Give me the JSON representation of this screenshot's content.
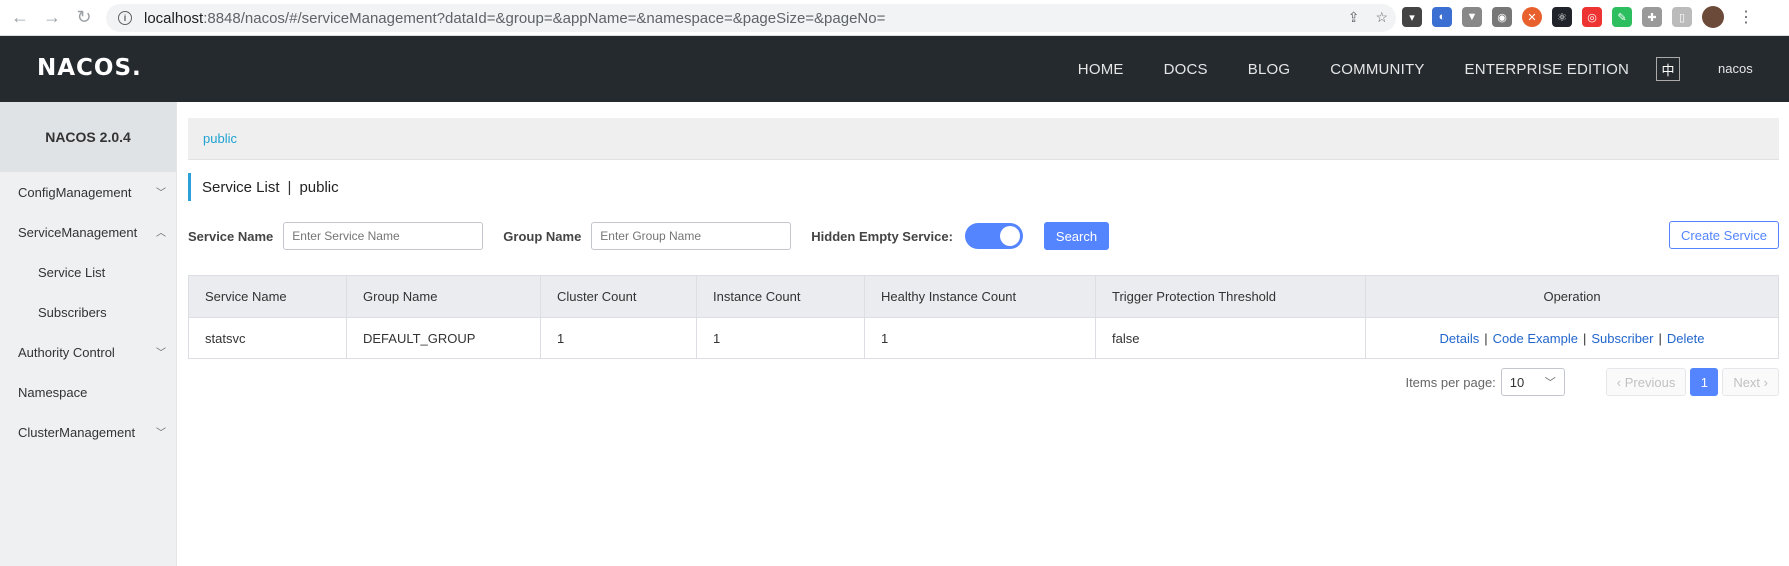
{
  "browser": {
    "url_host": "localhost",
    "url_rest": ":8848/nacos/#/serviceManagement?dataId=&group=&appName=&namespace=&pageSize=&pageNo="
  },
  "header": {
    "logo": "NACOS.",
    "nav": [
      "HOME",
      "DOCS",
      "BLOG",
      "COMMUNITY",
      "ENTERPRISE EDITION"
    ],
    "lang": "中",
    "user": "nacos"
  },
  "sidebar": {
    "title": "NACOS 2.0.4",
    "items": [
      {
        "label": "ConfigManagement",
        "chevron": "v"
      },
      {
        "label": "ServiceManagement",
        "chevron": "^"
      },
      {
        "label": "Service List",
        "chevron": ""
      },
      {
        "label": "Subscribers",
        "chevron": ""
      },
      {
        "label": "Authority Control",
        "chevron": "v"
      },
      {
        "label": "Namespace",
        "chevron": ""
      },
      {
        "label": "ClusterManagement",
        "chevron": "v"
      }
    ]
  },
  "namespace": {
    "current": "public"
  },
  "page": {
    "title": "Service List",
    "namespace": "public"
  },
  "search": {
    "service_label": "Service Name",
    "service_placeholder": "Enter Service Name",
    "group_label": "Group Name",
    "group_placeholder": "Enter Group Name",
    "hidden_label": "Hidden Empty Service:",
    "hidden_on": true,
    "search_button": "Search",
    "create_button": "Create Service"
  },
  "table": {
    "columns": [
      "Service Name",
      "Group Name",
      "Cluster Count",
      "Instance Count",
      "Healthy Instance Count",
      "Trigger Protection Threshold",
      "Operation"
    ],
    "rows": [
      {
        "service": "statsvc",
        "group": "DEFAULT_GROUP",
        "clusters": "1",
        "instances": "1",
        "healthy": "1",
        "threshold": "false",
        "ops": [
          "Details",
          "Code Example",
          "Subscriber",
          "Delete"
        ]
      }
    ]
  },
  "pagination": {
    "items_per_page_label": "Items per page:",
    "page_size": "10",
    "previous": "Previous",
    "current": "1",
    "next": "Next"
  }
}
